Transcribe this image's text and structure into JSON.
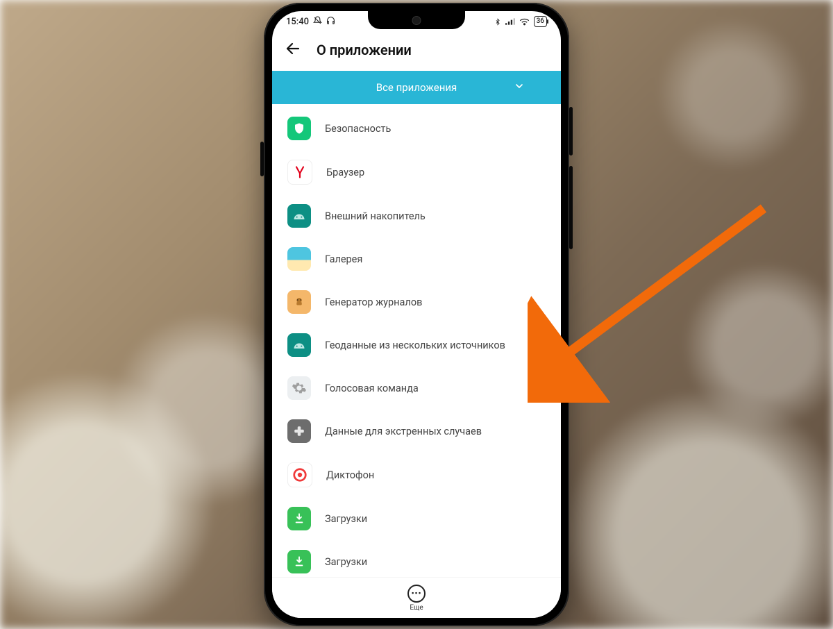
{
  "status": {
    "time": "15:40",
    "battery": "36"
  },
  "header": {
    "title": "О приложении"
  },
  "dropdown": {
    "label": "Все приложения"
  },
  "apps": [
    {
      "label": "Безопасность",
      "icon": "shield-icon"
    },
    {
      "label": "Браузер",
      "icon": "yandex-icon"
    },
    {
      "label": "Внешний накопитель",
      "icon": "android-icon"
    },
    {
      "label": "Галерея",
      "icon": "gallery-icon"
    },
    {
      "label": "Генератор журналов",
      "icon": "log-icon"
    },
    {
      "label": "Геоданные из нескольких источников",
      "icon": "android-icon"
    },
    {
      "label": "Голосовая команда",
      "icon": "gear-icon"
    },
    {
      "label": "Данные для экстренных случаев",
      "icon": "plus-icon"
    },
    {
      "label": "Диктофон",
      "icon": "recorder-icon"
    },
    {
      "label": "Загрузки",
      "icon": "download-icon"
    },
    {
      "label": "Загрузки",
      "icon": "download-icon"
    }
  ],
  "bottom": {
    "more_label": "Еще"
  }
}
